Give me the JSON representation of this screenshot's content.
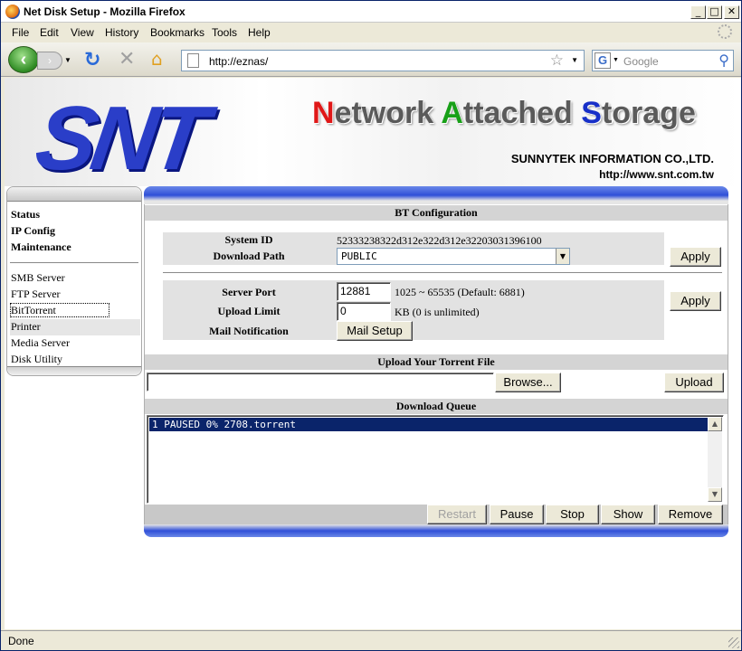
{
  "window": {
    "title": "Net Disk Setup - Mozilla Firefox"
  },
  "menu": [
    "File",
    "Edit",
    "View",
    "History",
    "Bookmarks",
    "Tools",
    "Help"
  ],
  "nav": {
    "url": "http://eznas/",
    "search_placeholder": "Google",
    "search_engine_glyph": "G"
  },
  "banner": {
    "logo": "SNT",
    "tagline_parts": [
      "N",
      "etwork ",
      "A",
      "ttached ",
      "S",
      "torage"
    ],
    "company": "SUNNYTEK INFORMATION CO.,LTD.",
    "website": "http://www.snt.com.tw"
  },
  "sidebar": {
    "primary": [
      "Status",
      "IP Config",
      "Maintenance"
    ],
    "secondary": [
      "SMB Server",
      "FTP Server",
      "BitTorrent",
      "Printer",
      "Media Server",
      "Disk Utility"
    ]
  },
  "bt_config": {
    "heading": "BT Configuration",
    "system_id_label": "System ID",
    "system_id": "52333238322d312e322d312e32203031396100",
    "download_path_label": "Download Path",
    "download_path": "PUBLIC",
    "apply1": "Apply",
    "server_port_label": "Server Port",
    "server_port": "12881",
    "server_port_hint": "1025 ~ 65535 (Default: 6881)",
    "upload_limit_label": "Upload Limit",
    "upload_limit": "0",
    "upload_limit_hint": "KB (0 is unlimited)",
    "mail_label": "Mail Notification",
    "mail_button": "Mail Setup",
    "apply2": "Apply"
  },
  "upload": {
    "heading": "Upload Your Torrent File",
    "file_value": "",
    "browse": "Browse...",
    "upload": "Upload"
  },
  "queue": {
    "heading": "Download Queue",
    "items": [
      "1 PAUSED 0% 2708.torrent"
    ],
    "buttons": {
      "restart": "Restart",
      "pause": "Pause",
      "stop": "Stop",
      "show": "Show",
      "remove": "Remove"
    }
  },
  "status": {
    "text": "Done"
  }
}
